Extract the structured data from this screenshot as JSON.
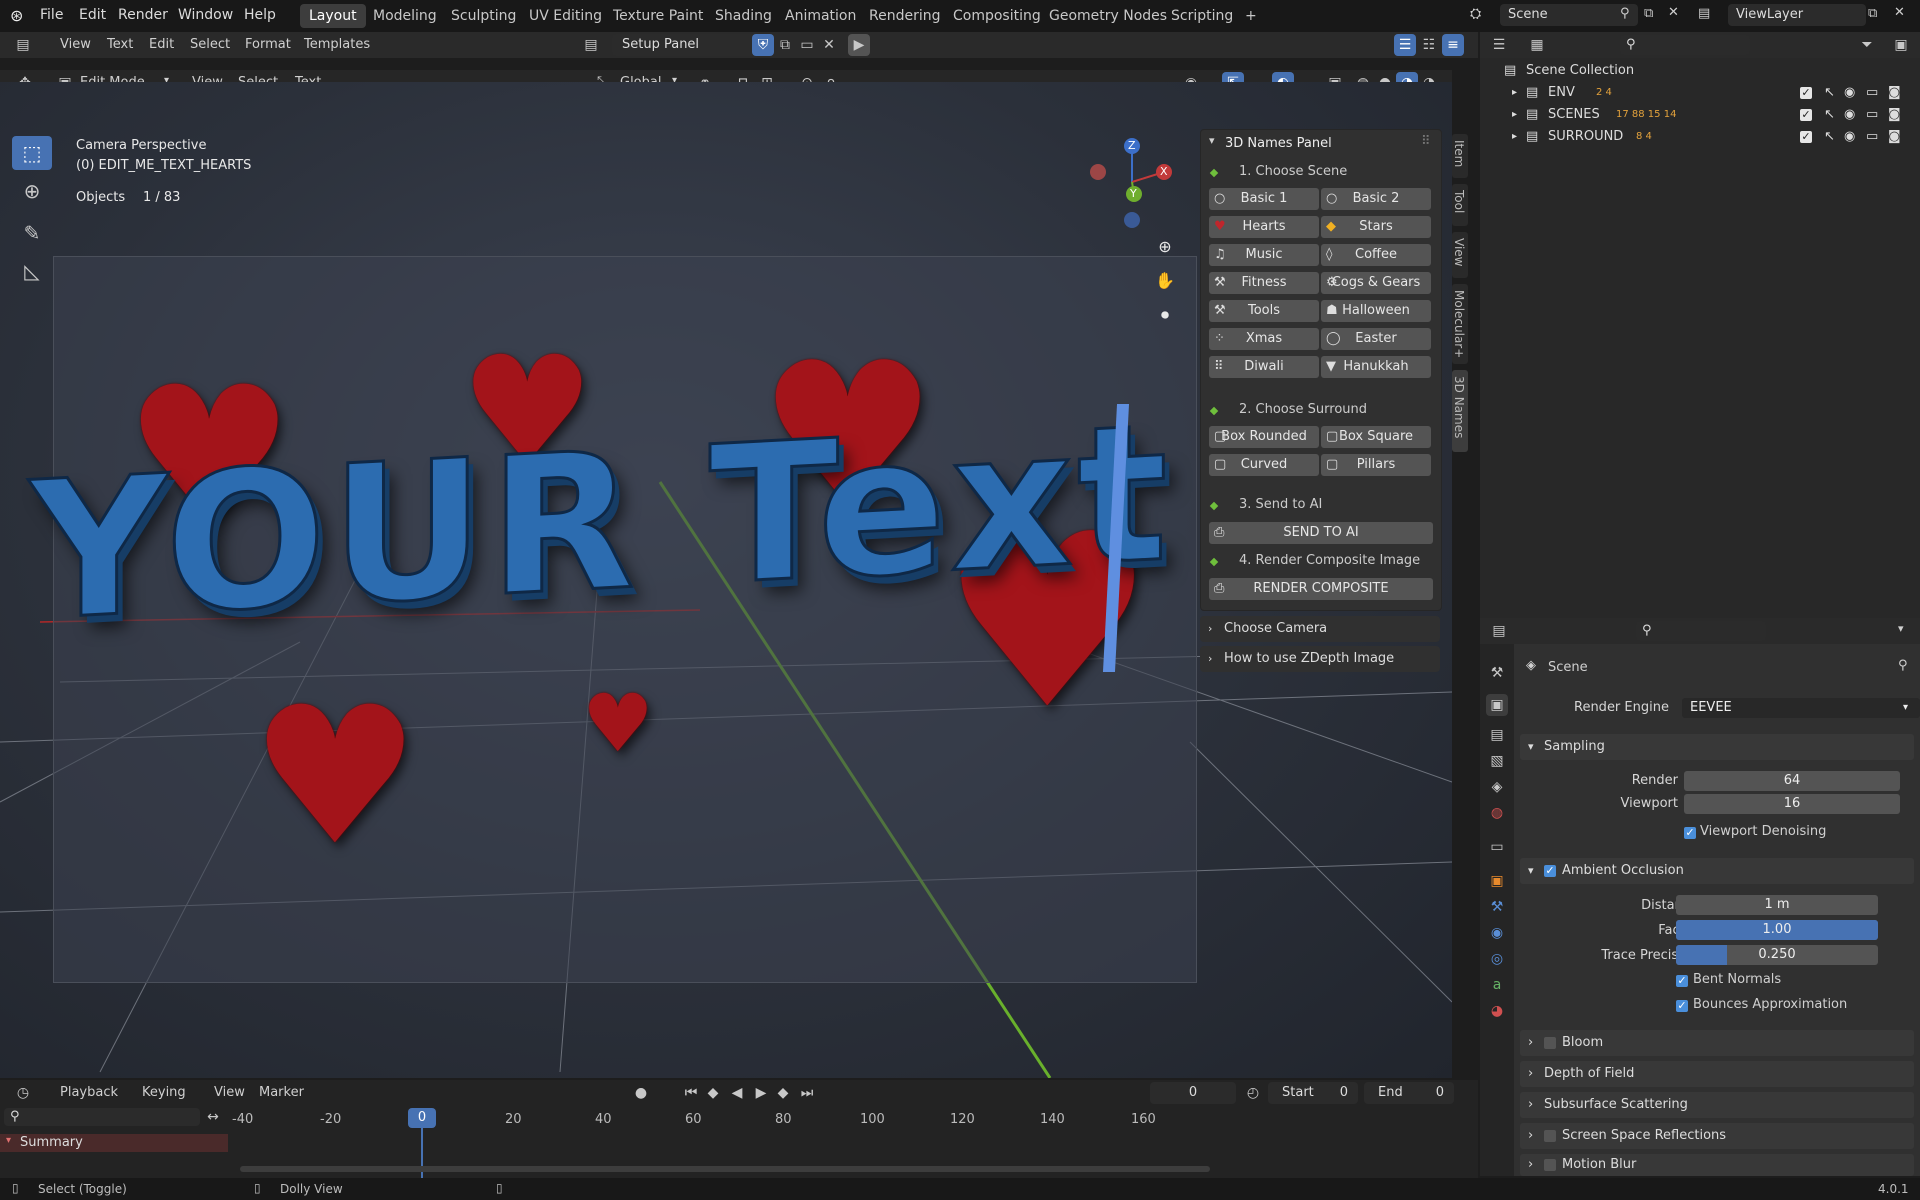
{
  "menubar": {
    "items": [
      "File",
      "Edit",
      "Render",
      "Window",
      "Help"
    ],
    "workspaces": [
      "Layout",
      "Modeling",
      "Sculpting",
      "UV Editing",
      "Texture Paint",
      "Shading",
      "Animation",
      "Rendering",
      "Compositing",
      "Geometry Nodes",
      "Scripting"
    ],
    "active_workspace": "Layout",
    "add_tab": "+",
    "scene_label": "Scene",
    "viewlayer_label": "ViewLayer"
  },
  "text_editor_header": {
    "menus": [
      "View",
      "Text",
      "Edit",
      "Select",
      "Format",
      "Templates"
    ],
    "script_name": "Setup Panel"
  },
  "viewport_header": {
    "mode": "Edit Mode",
    "menus": [
      "View",
      "Select",
      "Text"
    ],
    "transform_orientation": "Global"
  },
  "viewport_overlay": {
    "camera_label": "Camera Perspective",
    "object_name": "(0) EDIT_ME_TEXT_HEARTS",
    "objects_label": "Objects",
    "objects_count": "1 / 83",
    "scene_text": "YOUR Text",
    "gizmo": {
      "z": "Z",
      "y": "Y",
      "x": "X"
    }
  },
  "names_panel": {
    "title": "3D Names Panel",
    "step1": "1. Choose Scene",
    "scene_buttons": [
      {
        "left": "Basic 1",
        "right": "Basic 2"
      },
      {
        "left": "Hearts",
        "right": "Stars"
      },
      {
        "left": "Music",
        "right": "Coffee"
      },
      {
        "left": "Fitness",
        "right": "Cogs & Gears"
      },
      {
        "left": "Tools",
        "right": "Halloween"
      },
      {
        "left": "Xmas",
        "right": "Easter"
      },
      {
        "left": "Diwali",
        "right": "Hanukkah"
      }
    ],
    "step2": "2. Choose Surround",
    "surround_buttons": [
      {
        "left": "Box Rounded",
        "right": "Box Square"
      },
      {
        "left": "Curved",
        "right": "Pillars"
      }
    ],
    "step3": "3. Send to AI",
    "send_button": "SEND TO AI",
    "step4": "4. Render Composite Image",
    "render_button": "RENDER COMPOSITE",
    "choose_camera": "Choose Camera",
    "zdepth": "How to use ZDepth Image"
  },
  "sidebar_tabs": [
    "Item",
    "Tool",
    "View",
    "Molecular+",
    "3D Names"
  ],
  "outliner": {
    "root": "Scene Collection",
    "rows": [
      {
        "name": "ENV",
        "counts": "2  4"
      },
      {
        "name": "SCENES",
        "counts": "17 88 15 14"
      },
      {
        "name": "SURROUND",
        "counts": "8 4"
      }
    ]
  },
  "properties": {
    "context": "Scene",
    "render_engine_label": "Render Engine",
    "render_engine": "EEVEE",
    "sampling": {
      "title": "Sampling",
      "render_label": "Render",
      "render": "64",
      "viewport_label": "Viewport",
      "viewport": "16",
      "denoise": "Viewport Denoising"
    },
    "ao": {
      "title": "Ambient Occlusion",
      "distance_label": "Distance",
      "distance": "1 m",
      "factor_label": "Factor",
      "factor": "1.00",
      "factor_fill": 1.0,
      "trace_label": "Trace Precision",
      "trace": "0.250",
      "trace_fill": 0.25,
      "bent": "Bent Normals",
      "bounces": "Bounces Approximation"
    },
    "collapsed": [
      "Bloom",
      "Depth of Field",
      "Subsurface Scattering",
      "Screen Space Reflections",
      "Motion Blur"
    ]
  },
  "timeline": {
    "menus": [
      "Playback",
      "Keying",
      "View",
      "Marker"
    ],
    "current_frame": "0",
    "start_label": "Start",
    "start": "0",
    "end_label": "End",
    "end": "0",
    "ruler": [
      "-40",
      "-20",
      "0",
      "20",
      "40",
      "60",
      "80",
      "100",
      "120",
      "140",
      "160"
    ],
    "summary": "Summary"
  },
  "statusbar": {
    "left": "Select (Toggle)",
    "middle": "Dolly View",
    "version": "4.0.1"
  }
}
